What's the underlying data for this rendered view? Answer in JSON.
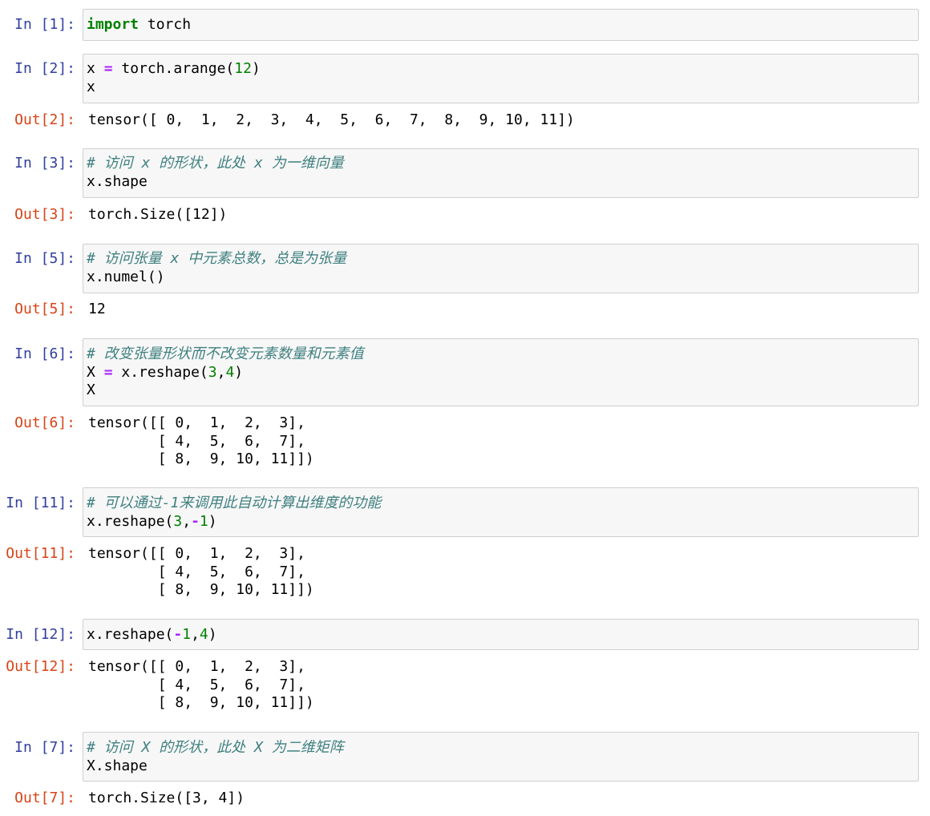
{
  "cells": [
    {
      "prompt_in": "In [1]:",
      "lines": [
        [
          {
            "t": "import",
            "c": "kw"
          },
          {
            "t": " torch",
            "c": ""
          }
        ]
      ],
      "outputs": []
    },
    {
      "prompt_in": "In [2]:",
      "lines": [
        [
          {
            "t": "x ",
            "c": ""
          },
          {
            "t": "=",
            "c": "op"
          },
          {
            "t": " torch.arange(",
            "c": ""
          },
          {
            "t": "12",
            "c": "num"
          },
          {
            "t": ")",
            "c": ""
          }
        ],
        [
          {
            "t": "x",
            "c": ""
          }
        ]
      ],
      "prompt_out": "Out[2]:",
      "outputs": [
        "tensor([ 0,  1,  2,  3,  4,  5,  6,  7,  8,  9, 10, 11])"
      ]
    },
    {
      "prompt_in": "In [3]:",
      "lines": [
        [
          {
            "t": "# 访问 x 的形状，此处 x 为一维向量",
            "c": "cm"
          }
        ],
        [
          {
            "t": "x.shape",
            "c": ""
          }
        ]
      ],
      "prompt_out": "Out[3]:",
      "outputs": [
        "torch.Size([12])"
      ]
    },
    {
      "prompt_in": "In [5]:",
      "lines": [
        [
          {
            "t": "# 访问张量 x 中元素总数，总是为张量",
            "c": "cm"
          }
        ],
        [
          {
            "t": "x.numel()",
            "c": ""
          }
        ]
      ],
      "prompt_out": "Out[5]:",
      "outputs": [
        "12"
      ]
    },
    {
      "prompt_in": "In [6]:",
      "lines": [
        [
          {
            "t": "# 改变张量形状而不改变元素数量和元素值",
            "c": "cm"
          }
        ],
        [
          {
            "t": "X ",
            "c": ""
          },
          {
            "t": "=",
            "c": "op"
          },
          {
            "t": " x.reshape(",
            "c": ""
          },
          {
            "t": "3",
            "c": "num"
          },
          {
            "t": ",",
            "c": ""
          },
          {
            "t": "4",
            "c": "num"
          },
          {
            "t": ")",
            "c": ""
          }
        ],
        [
          {
            "t": "X",
            "c": ""
          }
        ]
      ],
      "prompt_out": "Out[6]:",
      "outputs": [
        "tensor([[ 0,  1,  2,  3],",
        "        [ 4,  5,  6,  7],",
        "        [ 8,  9, 10, 11]])"
      ]
    },
    {
      "prompt_in": "In [11]:",
      "lines": [
        [
          {
            "t": "# 可以通过-1来调用此自动计算出维度的功能",
            "c": "cm"
          }
        ],
        [
          {
            "t": "x.reshape(",
            "c": ""
          },
          {
            "t": "3",
            "c": "num"
          },
          {
            "t": ",",
            "c": ""
          },
          {
            "t": "-",
            "c": "op"
          },
          {
            "t": "1",
            "c": "num"
          },
          {
            "t": ")",
            "c": ""
          }
        ]
      ],
      "prompt_out": "Out[11]:",
      "outputs": [
        "tensor([[ 0,  1,  2,  3],",
        "        [ 4,  5,  6,  7],",
        "        [ 8,  9, 10, 11]])"
      ]
    },
    {
      "prompt_in": "In [12]:",
      "lines": [
        [
          {
            "t": "x.reshape(",
            "c": ""
          },
          {
            "t": "-",
            "c": "op"
          },
          {
            "t": "1",
            "c": "num"
          },
          {
            "t": ",",
            "c": ""
          },
          {
            "t": "4",
            "c": "num"
          },
          {
            "t": ")",
            "c": ""
          }
        ]
      ],
      "prompt_out": "Out[12]:",
      "outputs": [
        "tensor([[ 0,  1,  2,  3],",
        "        [ 4,  5,  6,  7],",
        "        [ 8,  9, 10, 11]])"
      ]
    },
    {
      "prompt_in": "In [7]:",
      "lines": [
        [
          {
            "t": "# 访问 X 的形状，此处 X 为二维矩阵",
            "c": "cm"
          }
        ],
        [
          {
            "t": "X.shape",
            "c": ""
          }
        ]
      ],
      "prompt_out": "Out[7]:",
      "outputs": [
        "torch.Size([3, 4])"
      ]
    }
  ]
}
